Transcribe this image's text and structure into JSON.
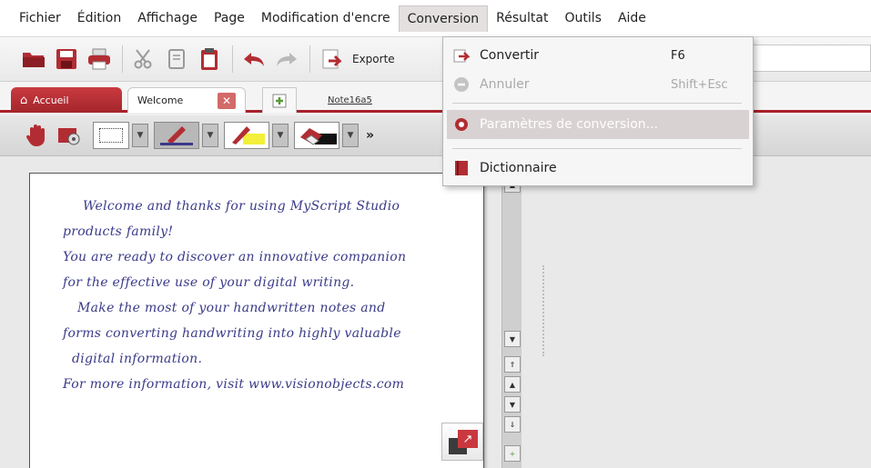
{
  "menubar": {
    "items": [
      "Fichier",
      "Édition",
      "Affichage",
      "Page",
      "Modification d'encre",
      "Conversion",
      "Résultat",
      "Outils",
      "Aide"
    ],
    "open_index": 5
  },
  "toolbar": {
    "export_label": "Exporte",
    "icons": [
      "open-folder-icon",
      "save-icon",
      "print-icon",
      "cut-icon",
      "copy-icon",
      "paste-icon",
      "undo-icon",
      "redo-icon",
      "export-icon"
    ]
  },
  "tabs": {
    "home_label": "Accueil",
    "welcome_label": "Welcome",
    "close_glyph": "✕",
    "note_label": "Note16a5"
  },
  "conversion_menu": {
    "items": [
      {
        "label": "Convertir",
        "shortcut": "F6",
        "state": "enabled"
      },
      {
        "label": "Annuler",
        "shortcut": "Shift+Esc",
        "state": "disabled"
      },
      {
        "label": "Paramètres de conversion...",
        "shortcut": "",
        "state": "hover"
      },
      {
        "label": "Dictionnaire",
        "shortcut": "",
        "state": "enabled"
      }
    ]
  },
  "document": {
    "lines": [
      "Welcome and thanks for using MyScript Studio",
      "products family!",
      "You are ready to discover an innovative companion",
      "for the effective use of your digital writing.",
      "Make the most of your handwritten notes and",
      "forms converting handwriting into highly valuable",
      "digital information.",
      "For more information, visit www.visionobjects.com"
    ]
  },
  "colors": {
    "accent": "#a8202a",
    "ink": "#3a3a88",
    "menu_hover": "#d9d2d2"
  }
}
